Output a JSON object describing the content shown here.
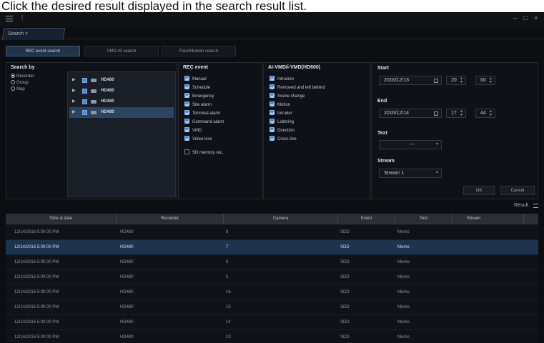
{
  "caption": "Click the desired result displayed in the search result list.",
  "titlebar": {
    "minimize": "–",
    "maximize": "□",
    "close": "×"
  },
  "tab": {
    "label": "Search ×"
  },
  "modes": [
    "REC event search",
    "VMD-IS search",
    "Face/Human search"
  ],
  "search_by": {
    "title": "Search by",
    "options": [
      {
        "label": "Recorder",
        "selected": true
      },
      {
        "label": "Group",
        "selected": false
      },
      {
        "label": "Map",
        "selected": false
      }
    ],
    "recorders": [
      {
        "name": "HD480",
        "selected": false
      },
      {
        "name": "HD480",
        "selected": false
      },
      {
        "name": "HD480",
        "selected": false
      },
      {
        "name": "HD480",
        "selected": true
      }
    ]
  },
  "rec_event": {
    "title": "REC event",
    "items": [
      "Manual",
      "Schedule",
      "Emergency",
      "Site alarm",
      "Terminal alarm",
      "Command alarm",
      "VMD",
      "Video loss"
    ],
    "extra": "SD memory rec."
  },
  "ai_vmd": {
    "title": "AI-VMD/i-VMD(HD600)",
    "items": [
      "Intrusion",
      "Removed and left behind",
      "Scene change",
      "Motion",
      "Intruder",
      "Loitering",
      "Direction",
      "Cross line"
    ]
  },
  "time": {
    "start_label": "Start",
    "start_date": "2016/12/13",
    "start_hour": "20",
    "start_min": "00",
    "end_label": "End",
    "end_date": "2016/12/14",
    "end_hour": "17",
    "end_min": "44",
    "text_label": "Text",
    "text_value": "---",
    "stream_label": "Stream",
    "stream_value": "Stream 1",
    "ok_label": "OK",
    "cancel_label": "Cancel"
  },
  "result": {
    "label": "Result",
    "columns": [
      "Time & date",
      "Recorder",
      "Camera",
      "Event",
      "Text",
      "Stream"
    ],
    "rows": [
      {
        "time": "12/14/2016 5:00:00 PM",
        "recorder": "HD480",
        "camera": "8",
        "event": "SDD",
        "text": "Memo",
        "stream": "",
        "selected": false
      },
      {
        "time": "12/14/2016 5:00:00 PM",
        "recorder": "HD480",
        "camera": "7",
        "event": "SDD",
        "text": "Memo",
        "stream": "",
        "selected": true
      },
      {
        "time": "12/14/2016 5:00:00 PM",
        "recorder": "HD480",
        "camera": "6",
        "event": "SDD",
        "text": "Memo",
        "stream": "",
        "selected": false
      },
      {
        "time": "12/14/2016 5:00:00 PM",
        "recorder": "HD480",
        "camera": "5",
        "event": "SDD",
        "text": "Memo",
        "stream": "",
        "selected": false
      },
      {
        "time": "12/14/2016 5:00:00 PM",
        "recorder": "HD480",
        "camera": "16",
        "event": "SDD",
        "text": "Memo",
        "stream": "",
        "selected": false
      },
      {
        "time": "12/14/2016 5:00:00 PM",
        "recorder": "HD480",
        "camera": "15",
        "event": "SDD",
        "text": "Memo",
        "stream": "",
        "selected": false
      },
      {
        "time": "12/14/2016 5:00:00 PM",
        "recorder": "HD480",
        "camera": "14",
        "event": "SDD",
        "text": "Memo",
        "stream": "",
        "selected": false
      },
      {
        "time": "12/14/2016 5:00:00 PM",
        "recorder": "HD480",
        "camera": "13",
        "event": "SDD",
        "text": "Memo",
        "stream": "",
        "selected": false
      }
    ]
  }
}
